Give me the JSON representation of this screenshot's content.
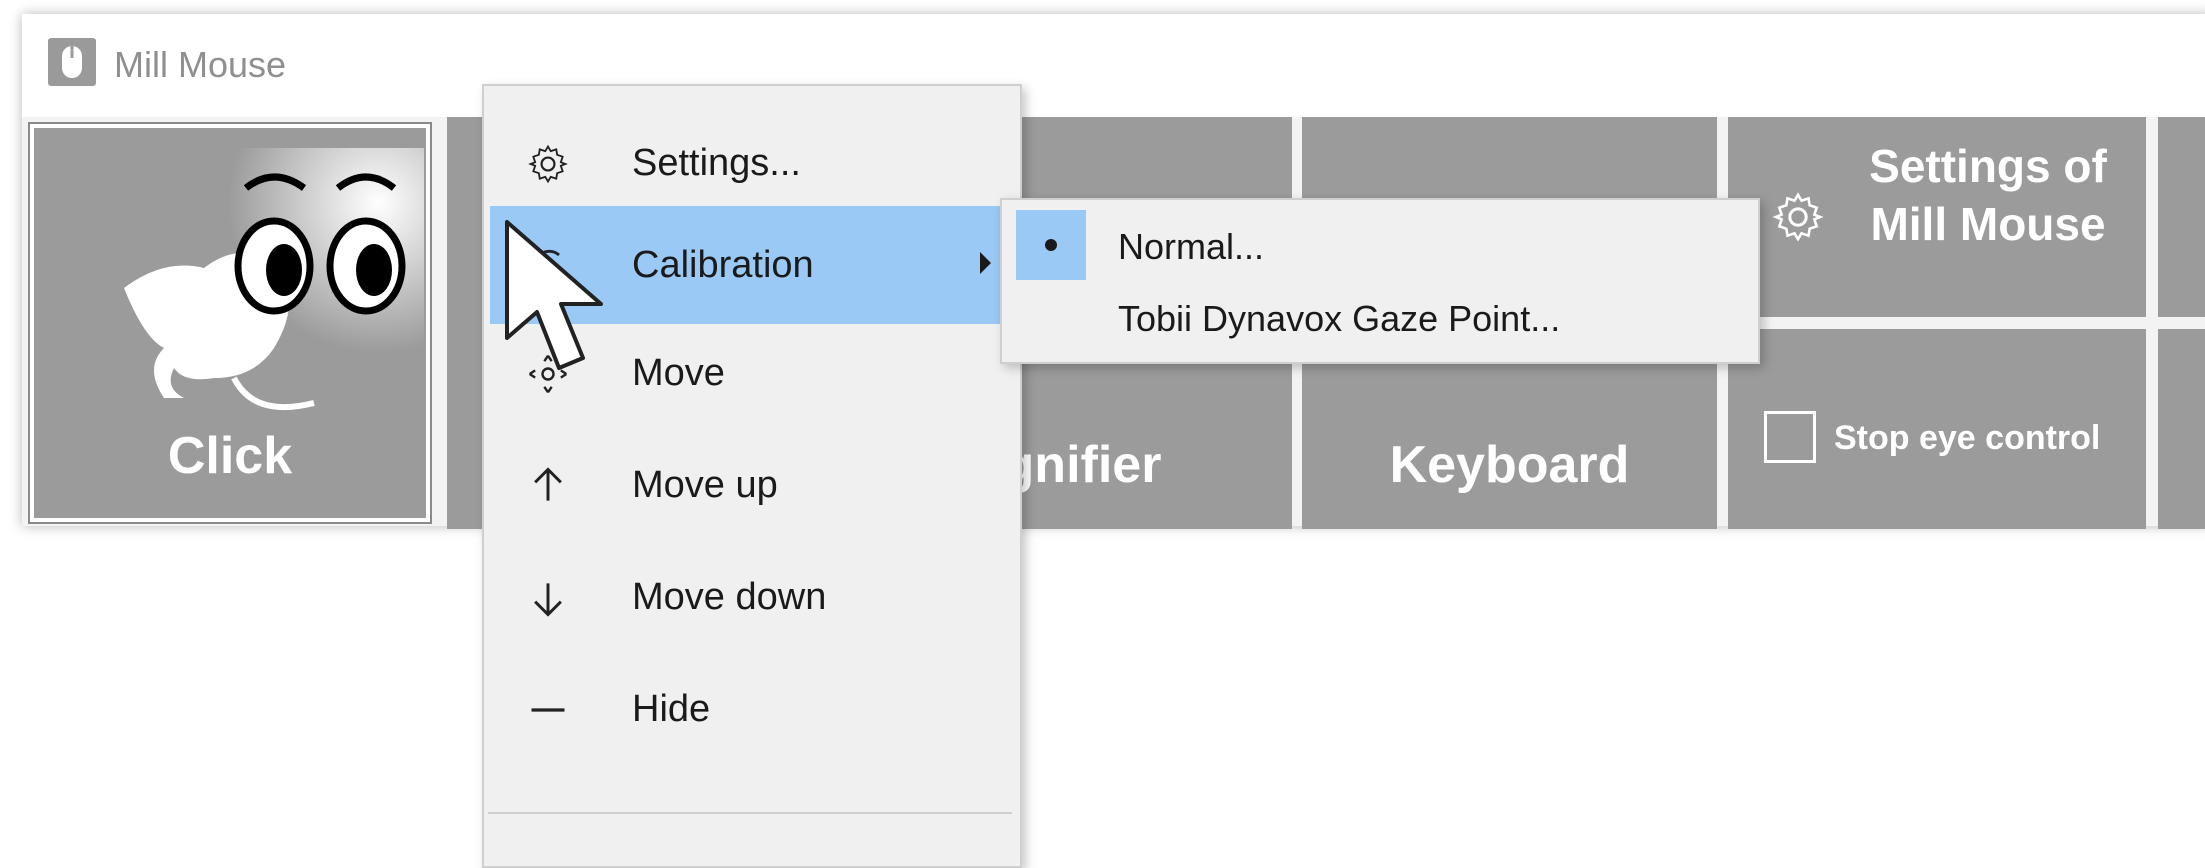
{
  "window": {
    "title": "Mill Mouse"
  },
  "tiles": {
    "click": "Click",
    "magnifier": "gnifier",
    "keyboard": "Keyboard",
    "settings": "Settings of Mill Mouse",
    "stop": "Stop eye control"
  },
  "menu": {
    "settings": "Settings...",
    "calibration": "Calibration",
    "move": "Move",
    "move_up": "Move up",
    "move_down": "Move down",
    "hide": "Hide"
  },
  "submenu": {
    "normal": "Normal...",
    "tobii": "Tobii Dynavox Gaze Point..."
  },
  "colors": {
    "tile": "#9b9b9b",
    "highlight": "#99c9f4",
    "menu_bg": "#f0f0f0"
  },
  "icons": {
    "app": "mouse-icon",
    "settings": "gear-icon",
    "move": "move-icon",
    "move_up": "arrow-up-icon",
    "move_down": "arrow-down-icon",
    "hide": "minus-icon"
  }
}
